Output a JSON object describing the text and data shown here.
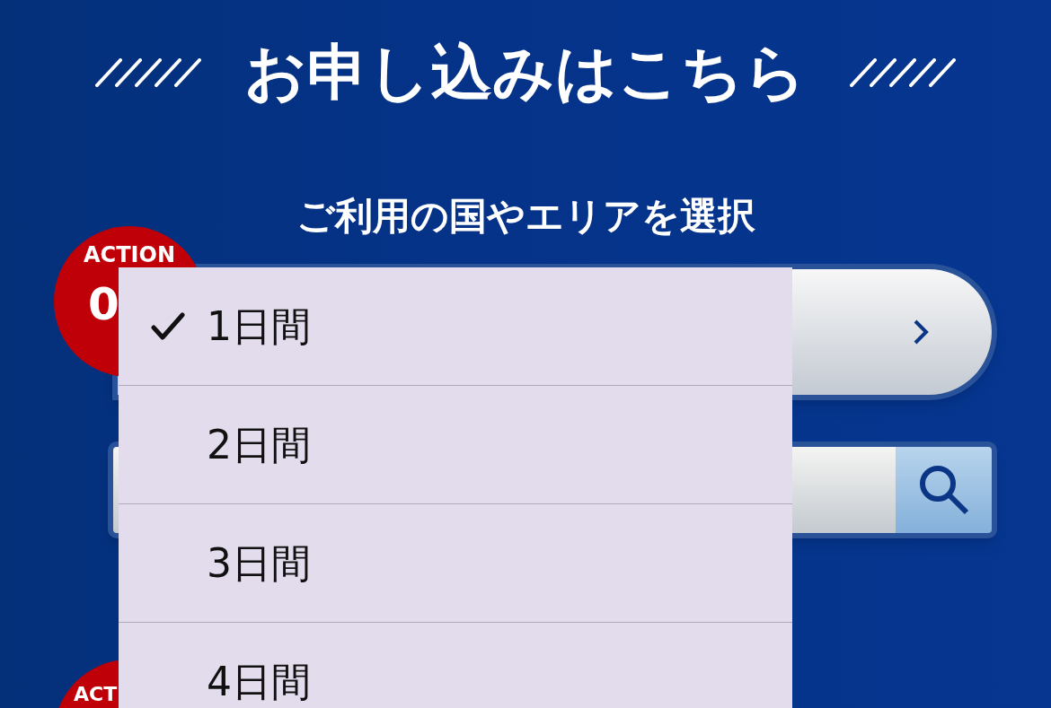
{
  "title": "お申し込みはこちら",
  "subtitle": "ご利用の国やエリアを選択",
  "steps": [
    {
      "label": "ACTION",
      "number": "0"
    },
    {
      "label": "ACT"
    }
  ],
  "dropdown": {
    "options": [
      {
        "label": "1日間",
        "selected": true
      },
      {
        "label": "2日間",
        "selected": false
      },
      {
        "label": "3日間",
        "selected": false
      },
      {
        "label": "4日間",
        "selected": false
      }
    ]
  }
}
